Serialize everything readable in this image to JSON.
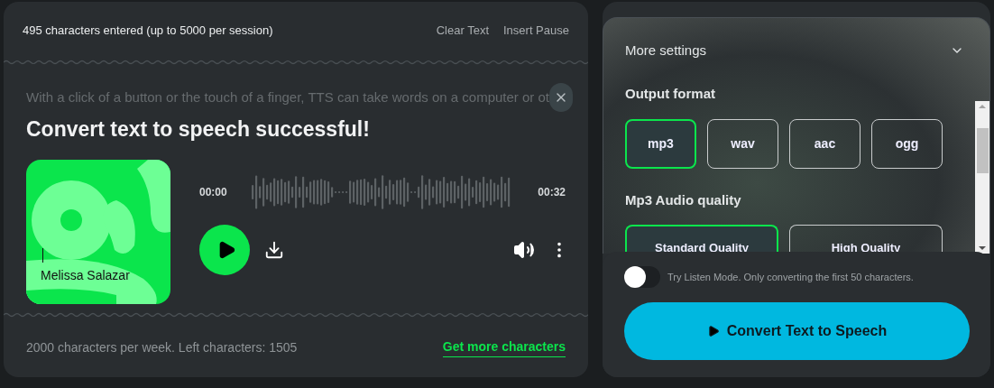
{
  "editor": {
    "count_text": "495 characters entered (up to 5000 per session)",
    "actions": [
      "Clear Text",
      "Insert Pause"
    ],
    "preview_text": "With a click of a button or the touch of a finger, TTS can take words on a computer or ot",
    "success_title": "Convert text to speech successful!",
    "voice_name": "Melissa Salazar",
    "player": {
      "start_time": "00:00",
      "end_time": "00:32",
      "playing": false
    },
    "footer_text": "2000 characters per week. Left characters: 1505",
    "footer_link": "Get more characters"
  },
  "settings": {
    "title": "More settings",
    "expanded": true,
    "format_label": "Output format",
    "formats": [
      {
        "label": "mp3",
        "selected": true
      },
      {
        "label": "wav",
        "selected": false
      },
      {
        "label": "aac",
        "selected": false
      },
      {
        "label": "ogg",
        "selected": false
      }
    ],
    "quality_label": "Mp3 Audio quality",
    "qualities": [
      {
        "label": "Standard Quality",
        "selected": true
      },
      {
        "label": "High Quality",
        "selected": false
      }
    ],
    "listen_mode": {
      "on": false,
      "label": "Try Listen Mode. Only converting the first 50 characters."
    },
    "convert_button": "Convert Text to Speech"
  }
}
